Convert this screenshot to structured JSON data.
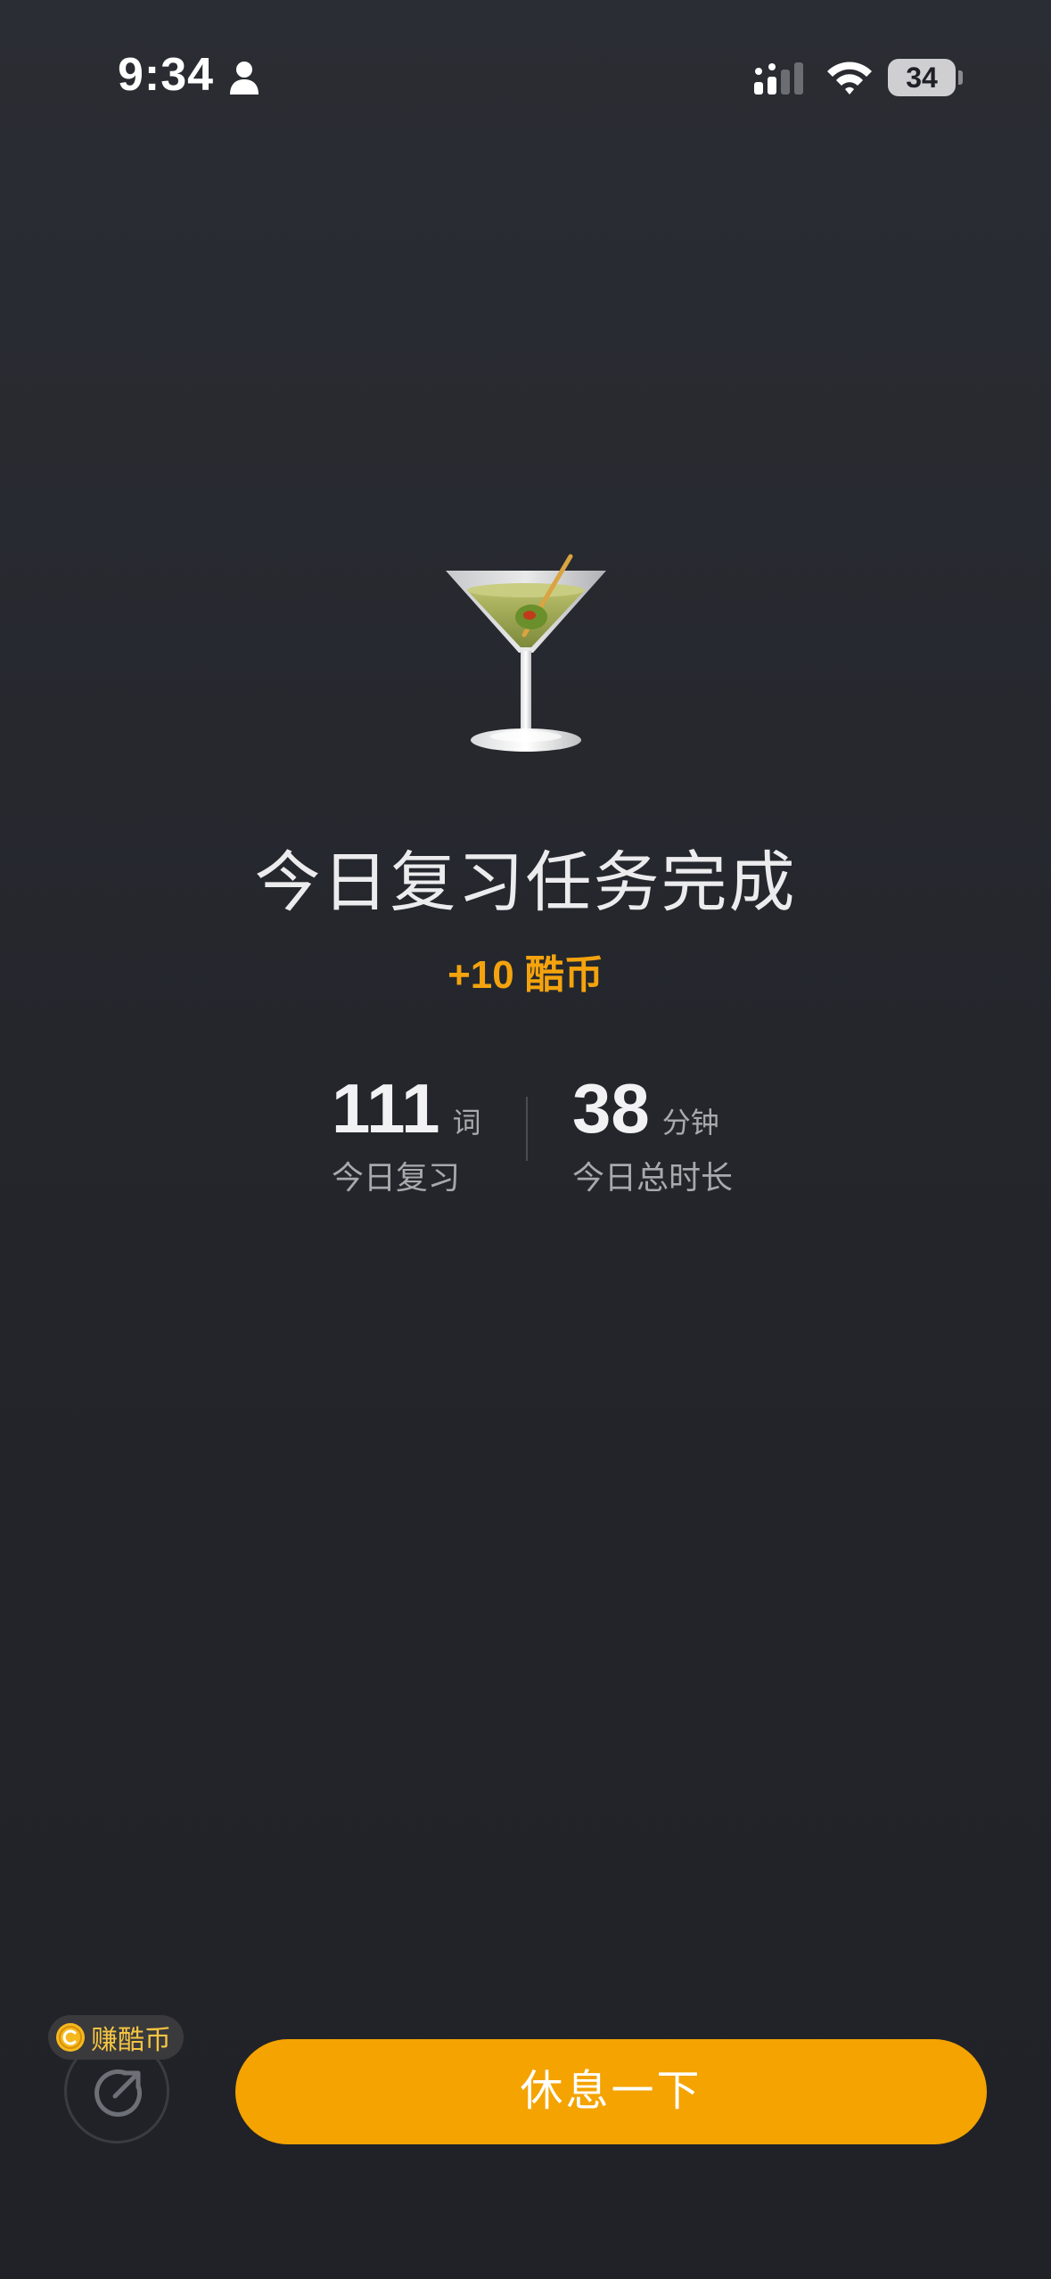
{
  "status_bar": {
    "time": "9:34",
    "battery": "34"
  },
  "icons": {
    "hero": "cocktail-glass-icon",
    "share": "share-arrow-icon",
    "coin": "coin-icon"
  },
  "main": {
    "title": "今日复习任务完成",
    "reward": "+10 酷币",
    "stats": {
      "review_count": "111",
      "review_unit": "词",
      "review_label": "今日复习",
      "duration_value": "38",
      "duration_unit": "分钟",
      "duration_label": "今日总时长"
    }
  },
  "bottom": {
    "earn_label": "赚酷币",
    "rest_button": "休息一下"
  },
  "colors": {
    "accent": "#f4a300",
    "reward_text": "#f4a30e",
    "background": "#25272d"
  }
}
